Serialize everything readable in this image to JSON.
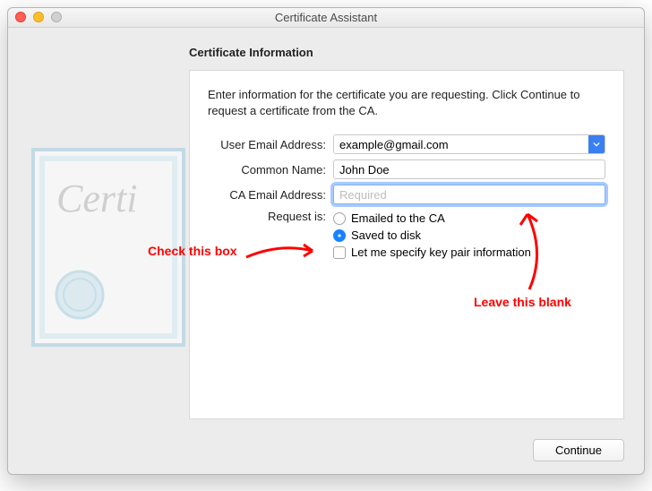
{
  "window": {
    "title": "Certificate Assistant"
  },
  "heading": "Certificate Information",
  "instructions": "Enter information for the certificate you are requesting. Click Continue to request a certificate from the CA.",
  "form": {
    "userEmail": {
      "label": "User Email Address:",
      "value": "example@gmail.com"
    },
    "commonName": {
      "label": "Common Name:",
      "value": "John Doe"
    },
    "caEmail": {
      "label": "CA Email Address:",
      "placeholder": "Required",
      "value": ""
    },
    "requestIs": {
      "label": "Request is:",
      "options": [
        {
          "label": "Emailed to the CA",
          "checked": false
        },
        {
          "label": "Saved to disk",
          "checked": true
        }
      ]
    },
    "keyPair": {
      "label": "Let me specify key pair information",
      "checked": false
    }
  },
  "buttons": {
    "continue": "Continue"
  },
  "annotations": {
    "checkBox": "Check this box",
    "leaveBlank": "Leave this blank"
  }
}
